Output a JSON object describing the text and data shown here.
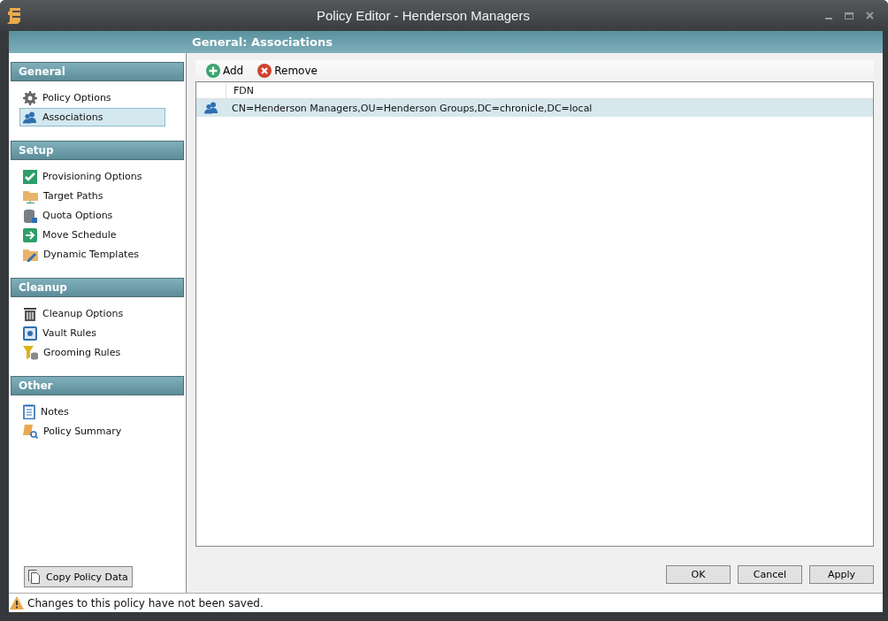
{
  "window": {
    "title": "Policy Editor - Henderson Managers"
  },
  "header": {
    "title": "General: Associations"
  },
  "sidebar": {
    "sections": [
      {
        "title": "General",
        "items": [
          {
            "label": "Policy Options",
            "selected": false
          },
          {
            "label": "Associations",
            "selected": true
          }
        ]
      },
      {
        "title": "Setup",
        "items": [
          {
            "label": "Provisioning Options",
            "selected": false
          },
          {
            "label": "Target Paths",
            "selected": false
          },
          {
            "label": "Quota Options",
            "selected": false
          },
          {
            "label": "Move Schedule",
            "selected": false
          },
          {
            "label": "Dynamic Templates",
            "selected": false
          }
        ]
      },
      {
        "title": "Cleanup",
        "items": [
          {
            "label": "Cleanup Options",
            "selected": false
          },
          {
            "label": "Vault Rules",
            "selected": false
          },
          {
            "label": "Grooming Rules",
            "selected": false
          }
        ]
      },
      {
        "title": "Other",
        "items": [
          {
            "label": "Notes",
            "selected": false
          },
          {
            "label": "Policy Summary",
            "selected": false
          }
        ]
      }
    ],
    "copy_button": "Copy Policy Data"
  },
  "toolbar": {
    "buttons": [
      {
        "label": "Add",
        "kind": "add"
      },
      {
        "label": "Remove",
        "kind": "remove"
      }
    ]
  },
  "table": {
    "columns": [
      "FDN"
    ],
    "rows": [
      {
        "fdn": "CN=Henderson Managers,OU=Henderson Groups,DC=chronicle,DC=local",
        "selected": true
      }
    ]
  },
  "buttons": [
    "OK",
    "Cancel",
    "Apply"
  ],
  "status_bar": {
    "message": "Changes to this policy have not been saved."
  }
}
